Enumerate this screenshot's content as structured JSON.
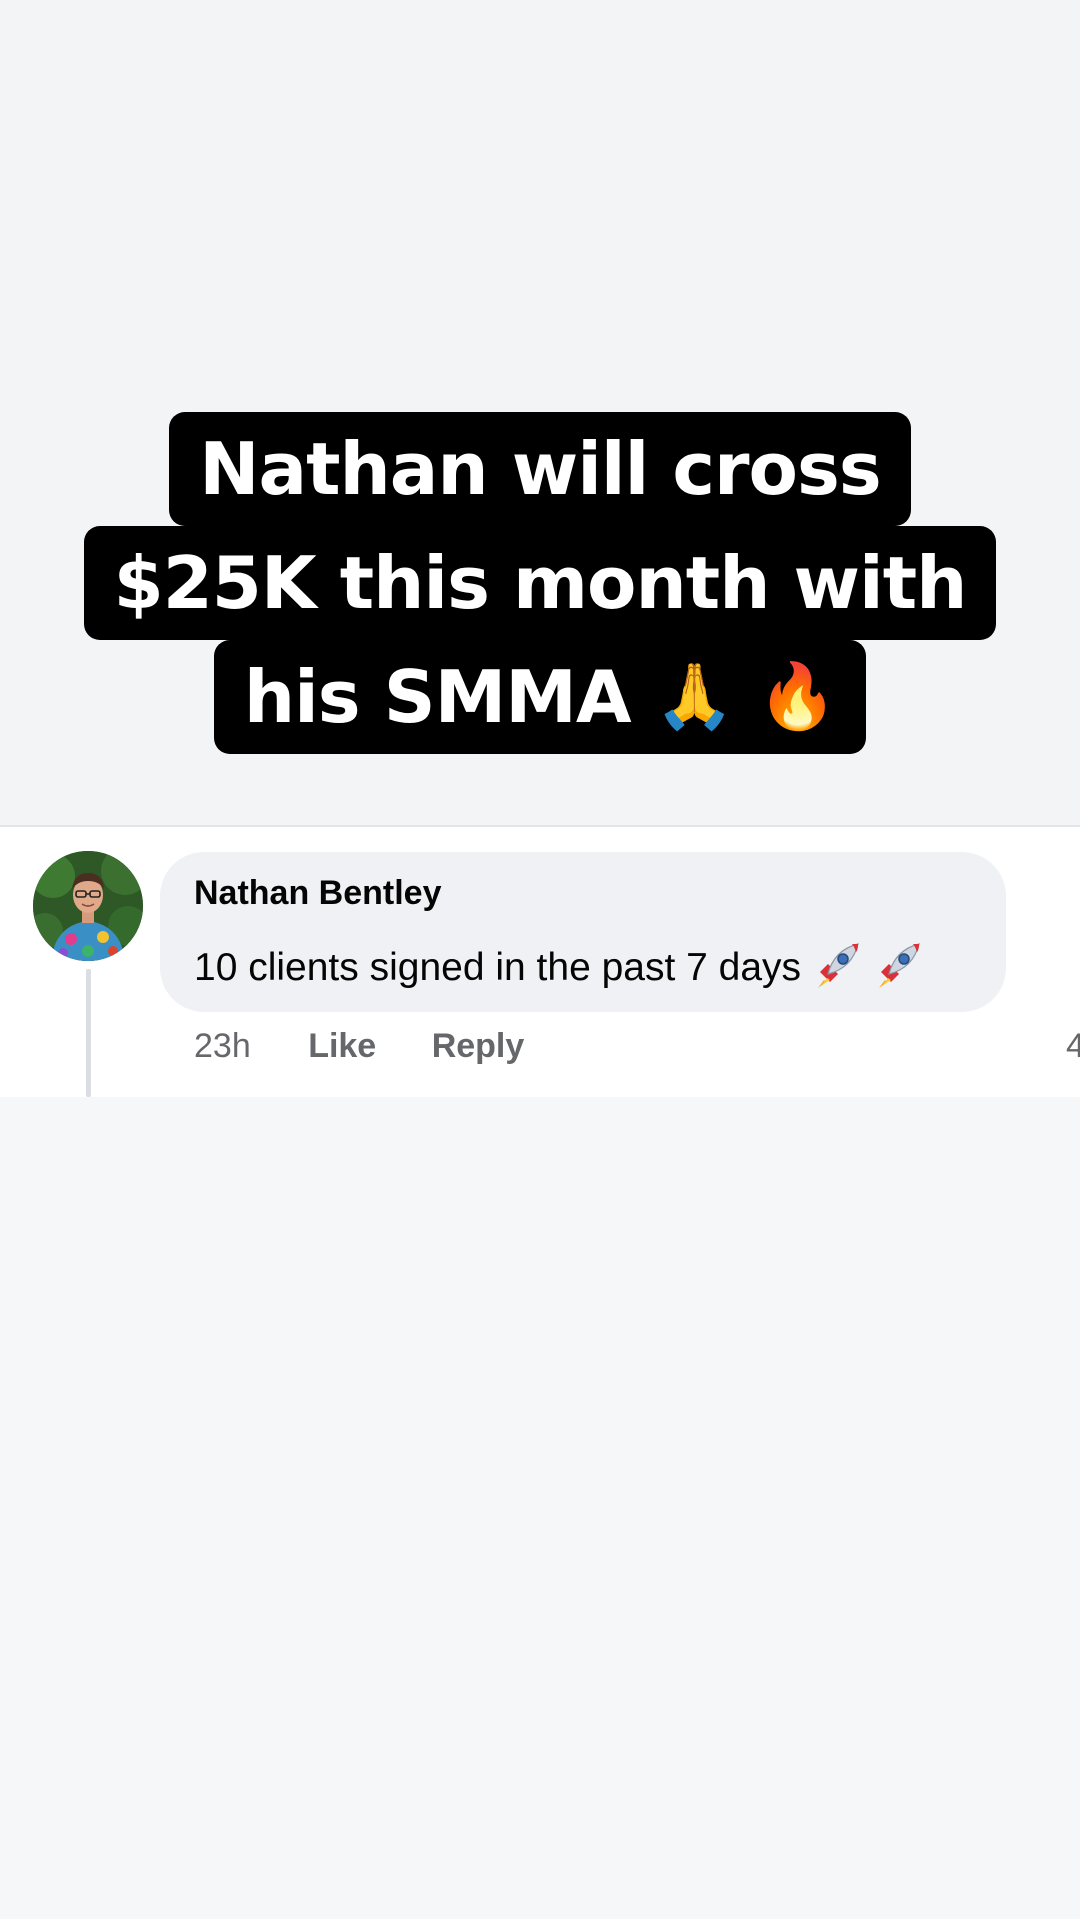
{
  "caption": {
    "line1": "Nathan will cross",
    "line2": "$25K this month with",
    "line3_text": "his SMMA",
    "emoji_pray": "🙏",
    "emoji_fire": "🔥"
  },
  "comment": {
    "author": "Nathan Bentley",
    "message": "10 clients signed in the past 7 days",
    "trailing_icons": [
      "rocket-icon",
      "rocket-icon"
    ],
    "time": "23h",
    "like_label": "Like",
    "reply_label": "Reply",
    "edge_glyph": "4"
  },
  "colors": {
    "caption_bg": "#000000",
    "caption_text": "#ffffff",
    "bubble_bg": "#eff1f4",
    "meta_text": "#65676b"
  }
}
